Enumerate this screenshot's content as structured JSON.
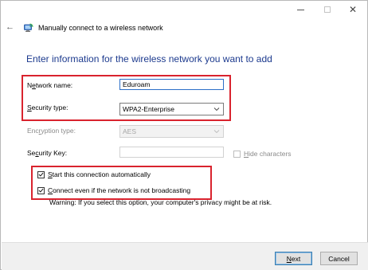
{
  "window": {
    "title": "Manually connect to a wireless network",
    "controls": {
      "minimize": "minimize-icon",
      "maximize": "maximize-icon",
      "close": "close-icon",
      "close_glyph": "✕"
    },
    "back": "back-arrow-icon",
    "back_glyph": "←",
    "network_icon": "wireless-network-icon"
  },
  "heading": "Enter information for the wireless network you want to add",
  "form": {
    "network_name": {
      "label_pre": "N",
      "label_u": "e",
      "label_post": "twork name:",
      "value": "Eduroam"
    },
    "security_type": {
      "label_pre": "",
      "label_u": "S",
      "label_post": "ecurity type:",
      "value": "WPA2-Enterprise"
    },
    "encryption_type": {
      "label_pre": "Enc",
      "label_u": "r",
      "label_post": "yption type:",
      "value": "AES"
    },
    "security_key": {
      "label_pre": "Se",
      "label_u": "c",
      "label_post": "urity Key:",
      "value": ""
    },
    "hide_characters": {
      "label_pre": "",
      "label_u": "H",
      "label_post": "ide characters",
      "checked": false
    },
    "start_automatically": {
      "label_pre": "",
      "label_u": "S",
      "label_post": "tart this connection automatically",
      "checked": true
    },
    "connect_not_broadcasting": {
      "label_pre": "",
      "label_u": "C",
      "label_post": "onnect even if the network is not broadcasting",
      "checked": true
    },
    "warning": "Warning: If you select this option, your computer's privacy might be at risk."
  },
  "footer": {
    "next_pre": "",
    "next_u": "N",
    "next_post": "ext",
    "cancel": "Cancel"
  },
  "colors": {
    "heading": "#1c3a8e",
    "highlight": "#d9232e",
    "focus_border": "#2b6fc8"
  }
}
